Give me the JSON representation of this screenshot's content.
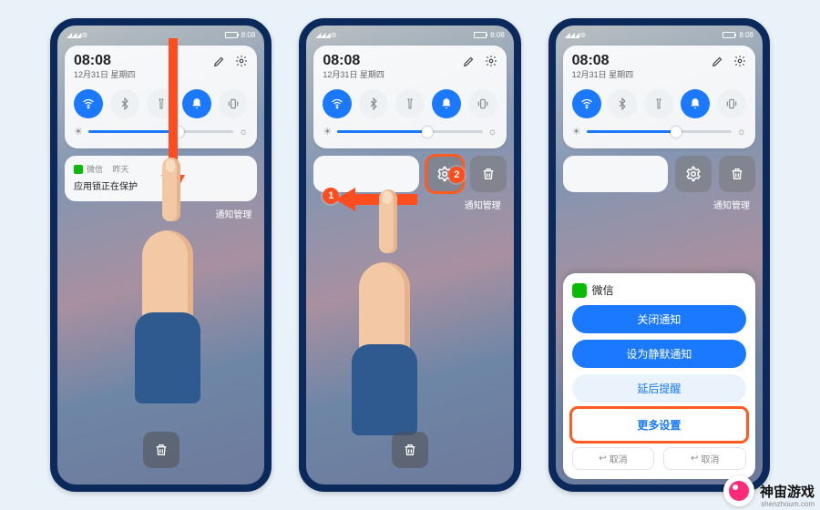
{
  "status": {
    "time": "8:08",
    "signal_glyphs": "◢◢◢ ⊚"
  },
  "panel": {
    "time": "08:08",
    "date": "12月31日 星期四",
    "brightness_pct": 62
  },
  "toggles": [
    {
      "name": "wifi",
      "on": true
    },
    {
      "name": "bluetooth",
      "on": false
    },
    {
      "name": "flashlight",
      "on": false
    },
    {
      "name": "bell",
      "on": true
    },
    {
      "name": "vibrate",
      "on": false
    }
  ],
  "notification": {
    "app": "微信",
    "when": "昨天",
    "text": "应用锁正在保护"
  },
  "labels": {
    "notif_mgmt": "通知管理"
  },
  "steps": {
    "one": "1",
    "two": "2"
  },
  "sheet": {
    "app": "微信",
    "btn_close": "关闭通知",
    "btn_silent": "设为静默通知",
    "btn_delay": "延后提醒",
    "btn_more": "更多设置",
    "foot_cancel": "取消",
    "foot_ok": "取消"
  },
  "watermark": {
    "title": "神宙游戏",
    "url": "shenzhoum.com"
  }
}
